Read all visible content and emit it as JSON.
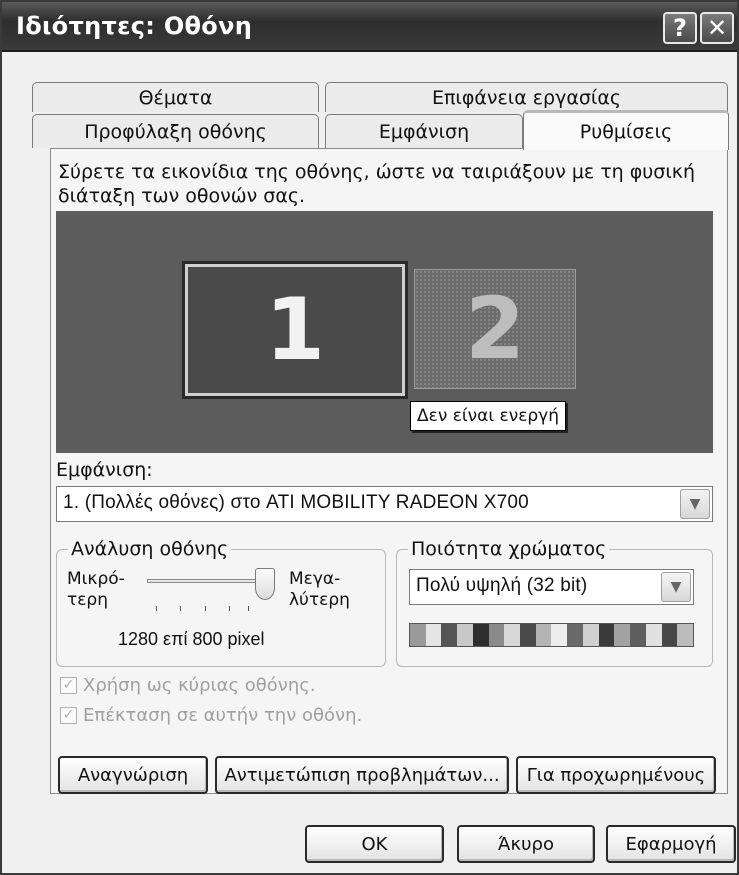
{
  "window": {
    "title": "Ιδιότητες: Οθόνη",
    "help_glyph": "?",
    "close_glyph": "✕"
  },
  "tabs": {
    "row1": [
      "Θέματα",
      "Επιφάνεια εργασίας"
    ],
    "row2": [
      "Προφύλαξη οθόνης",
      "Εμφάνιση",
      "Ρυθμίσεις"
    ],
    "active": "Ρυθμίσεις"
  },
  "settings": {
    "instruction": "Σύρετε τα εικονίδια της οθόνης, ώστε να ταιριάξουν με τη φυσική διάταξη των οθονών σας.",
    "monitors": [
      {
        "number": "1",
        "active": true
      },
      {
        "number": "2",
        "active": false
      }
    ],
    "tooltip": "Δεν είναι ενεργή",
    "display_label": "Εμφάνιση:",
    "display_value": "1. (Πολλές οθόνες) στο ATI MOBILITY RADEON X700",
    "resolution": {
      "group_title": "Ανάλυση οθόνης",
      "less_label_line1": "Μικρό-",
      "less_label_line2": "τερη",
      "more_label_line1": "Μεγα-",
      "more_label_line2": "λύτερη",
      "value_text": "1280 επί 800 pixel",
      "slider_position": 1.0
    },
    "color_quality": {
      "group_title": "Ποιότητα χρώματος",
      "selected": "Πολύ υψηλή (32 bit)"
    },
    "checkboxes": [
      {
        "label": "Χρήση ως κύριας οθόνης.",
        "checked": true,
        "enabled": false
      },
      {
        "label": "Επέκταση σε αυτήν την οθόνη.",
        "checked": true,
        "enabled": false
      }
    ],
    "buttons": {
      "identify": "Αναγνώριση",
      "troubleshoot": "Αντιμετώπιση προβλημάτων...",
      "advanced": "Για προχωρημένους"
    }
  },
  "footer": {
    "ok": "OK",
    "cancel": "Άκυρο",
    "apply": "Εφαρμογή"
  },
  "colors": {
    "titlebar": "#3a3a3a",
    "monitor_area": "#5c5c5c",
    "monitor_active": "#4a4a4a",
    "monitor_inactive": "#6c6c6c"
  }
}
